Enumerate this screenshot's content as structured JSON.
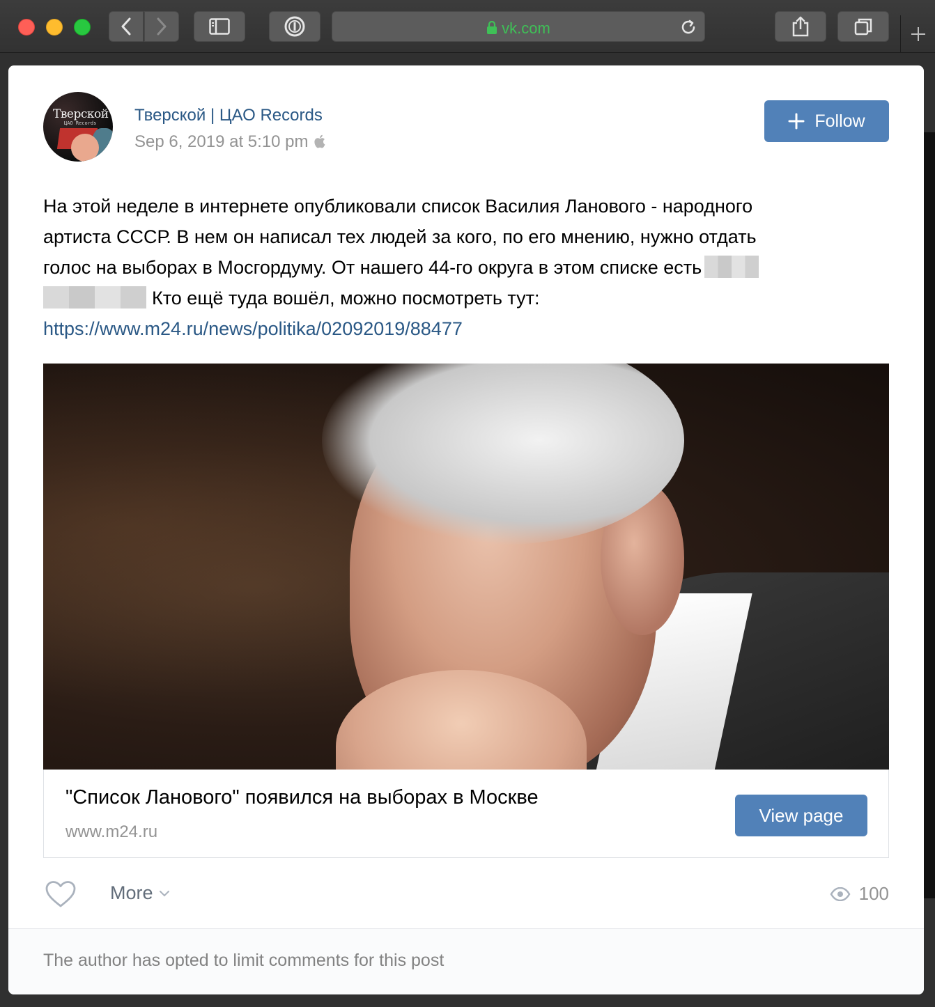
{
  "browser": {
    "url": "vk.com"
  },
  "post": {
    "author": "Тверской | ЦАО Records",
    "date": "Sep 6, 2019 at 5:10 pm",
    "follow_label": "Follow",
    "avatar_text": "Тверской",
    "avatar_subtext": "ЦАО Records",
    "text_line1": "На этой неделе в интернете опубликовали список Василия Ланового - народного",
    "text_line2": "артиста СССР. В нем он написал тех людей за кого, по его мнению, нужно отдать",
    "text_line3": "голос на выборах в Мосгордуму. От нашего 44-го округа в этом списке есть",
    "text_line4": "Кто ещё туда вошёл, можно посмотреть тут:",
    "link": "https://www.m24.ru/news/politika/02092019/88477"
  },
  "preview": {
    "title": "\"Список Ланового\" появился на выборах в Москве",
    "domain": "www.m24.ru",
    "button_label": "View page"
  },
  "actions": {
    "more_label": "More",
    "views_count": "100"
  },
  "footer": {
    "note": "The author has opted to limit comments for this post"
  },
  "colors": {
    "accent": "#5181b8",
    "link": "#2a5885",
    "url_green": "#3fc057"
  }
}
